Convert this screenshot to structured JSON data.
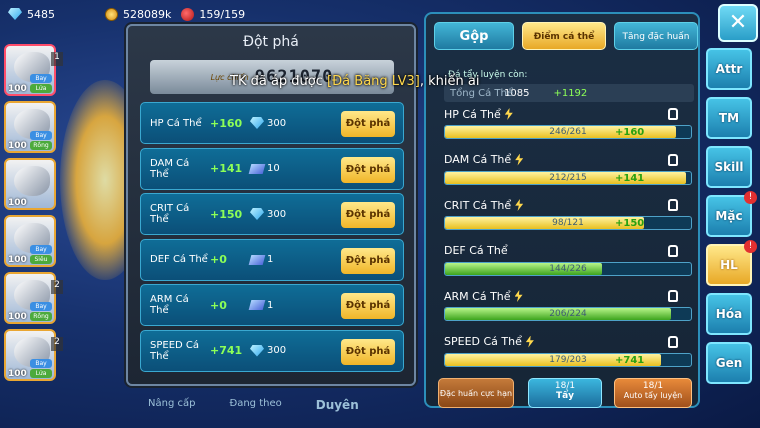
{
  "topbar": {
    "diamonds": "5485",
    "gold": "528089k",
    "stamina": "159/159"
  },
  "team": [
    {
      "level": "100",
      "tag1": "Bay",
      "tag2": "Lửa",
      "num": "1",
      "selected": true
    },
    {
      "level": "100",
      "tag1": "Bay",
      "tag2": "Rồng",
      "num": "",
      "selected": false
    },
    {
      "level": "100",
      "tag1": "",
      "tag2": "",
      "num": "",
      "selected": false
    },
    {
      "level": "100",
      "tag1": "Bay",
      "tag2": "Siêu",
      "num": "",
      "selected": false
    },
    {
      "level": "100",
      "tag1": "Bay",
      "tag2": "Rồng",
      "num": "2",
      "selected": false
    },
    {
      "level": "100",
      "tag1": "Bay",
      "tag2": "Lửa",
      "num": "2",
      "selected": false
    }
  ],
  "breakthrough": {
    "title": "Đột phá",
    "power_label": "Lực chiến",
    "power_value": "9621070",
    "button_label": "Đột phá",
    "rows": [
      {
        "name": "HP Cá Thể",
        "bonus": "+160",
        "cost": "300",
        "cost_icon": "diamond-icon"
      },
      {
        "name": "DAM Cá Thể",
        "bonus": "+141",
        "cost": "10",
        "cost_icon": "stone-icon"
      },
      {
        "name": "CRIT Cá Thể",
        "bonus": "+150",
        "cost": "300",
        "cost_icon": "diamond-icon"
      },
      {
        "name": "DEF Cá Thể",
        "bonus": "+0",
        "cost": "1",
        "cost_icon": "stone-icon"
      },
      {
        "name": "ARM Cá Thể",
        "bonus": "+0",
        "cost": "1",
        "cost_icon": "stone-icon"
      },
      {
        "name": "SPEED Cá Thể",
        "bonus": "+741",
        "cost": "300",
        "cost_icon": "diamond-icon"
      }
    ],
    "bottom_tabs": [
      "Nâng cấp",
      "Đang theo",
      "Duyên"
    ]
  },
  "toast": {
    "prefix": "TK đã áp được ",
    "highlight": "[Đá Băng LV3]",
    "suffix": ", khiến ai"
  },
  "stats_panel": {
    "tabs": [
      "Gộp",
      "Điểm cá thể",
      "Tăng đặc huấn"
    ],
    "active_tab": 1,
    "remaining_label": "Đá tẩy luyện còn:",
    "total_label": "Tổng Cá Thể",
    "total_value": "1085",
    "total_plus": "+1192",
    "stats": [
      {
        "name": "HP Cá Thể",
        "value": "246/261",
        "plus": "+160",
        "bolt": true,
        "fill": 0.94,
        "color": "yellow"
      },
      {
        "name": "DAM Cá Thể",
        "value": "212/215",
        "plus": "+141",
        "bolt": true,
        "fill": 0.98,
        "color": "yellow"
      },
      {
        "name": "CRIT Cá Thể",
        "value": "98/121",
        "plus": "+150",
        "bolt": true,
        "fill": 0.81,
        "color": "yellow"
      },
      {
        "name": "DEF Cá Thể",
        "value": "144/226",
        "plus": "",
        "bolt": false,
        "fill": 0.64,
        "color": "green"
      },
      {
        "name": "ARM Cá Thể",
        "value": "206/224",
        "plus": "",
        "bolt": true,
        "fill": 0.92,
        "color": "green"
      },
      {
        "name": "SPEED Cá Thể",
        "value": "179/203",
        "plus": "+741",
        "bolt": true,
        "fill": 0.88,
        "color": "yellow"
      }
    ],
    "bottom_buttons": [
      {
        "label": "Đặc huấn cực hạn",
        "count": ""
      },
      {
        "label": "Tẩy",
        "count": "18/1"
      },
      {
        "label": "Auto tẩy luyện",
        "count": "18/1"
      }
    ]
  },
  "side_tabs": [
    "Attr",
    "TM",
    "Skill",
    "Mặc",
    "HL",
    "Hóa",
    "Gen"
  ],
  "side_active": "HL",
  "close_label": "✕"
}
